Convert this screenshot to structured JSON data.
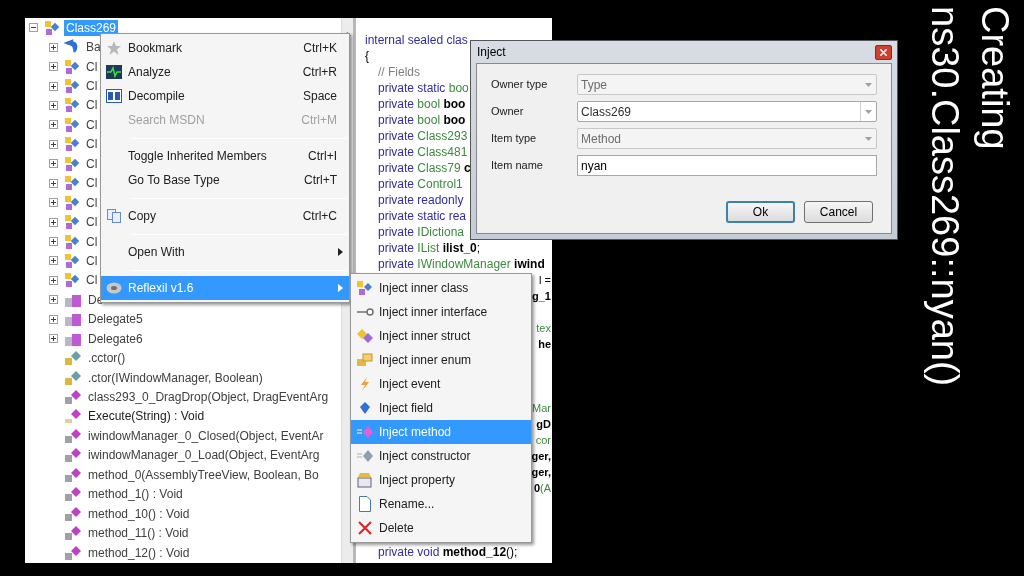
{
  "tree": {
    "items": [
      {
        "label": "Class269",
        "kind": "class",
        "selected": true,
        "expanded": true,
        "children": [
          {
            "label": "Ba",
            "kind": "base",
            "selected": false,
            "expanded": false
          },
          {
            "label": "Cl",
            "kind": "class",
            "selected": false,
            "expanded": false
          },
          {
            "label": "Cl",
            "kind": "class",
            "selected": false,
            "expanded": false
          },
          {
            "label": "Cl",
            "kind": "class",
            "selected": false,
            "expanded": false
          },
          {
            "label": "Cl",
            "kind": "class",
            "selected": false,
            "expanded": false
          },
          {
            "label": "Cl",
            "kind": "class",
            "selected": false,
            "expanded": false
          },
          {
            "label": "Cl",
            "kind": "class",
            "selected": false,
            "expanded": false
          },
          {
            "label": "Cl",
            "kind": "class",
            "selected": false,
            "expanded": false
          },
          {
            "label": "Cl",
            "kind": "class",
            "selected": false,
            "expanded": false
          },
          {
            "label": "Cl",
            "kind": "class",
            "selected": false,
            "expanded": false
          },
          {
            "label": "Cl",
            "kind": "class",
            "selected": false,
            "expanded": false
          },
          {
            "label": "Cl",
            "kind": "class",
            "selected": false,
            "expanded": false
          },
          {
            "label": "Cl",
            "kind": "class",
            "selected": false,
            "expanded": false
          },
          {
            "label": "De",
            "kind": "delegate",
            "selected": false,
            "expanded": false
          },
          {
            "label": "Delegate5",
            "kind": "delegate",
            "selected": false,
            "expanded": false
          },
          {
            "label": "Delegate6",
            "kind": "delegate",
            "selected": false,
            "expanded": false
          },
          {
            "label": ".cctor()",
            "kind": "ctor",
            "selected": false
          },
          {
            "label": ".ctor(IWindowManager, Boolean)",
            "kind": "ctor",
            "selected": false
          },
          {
            "label": "class293_0_DragDrop(Object, DragEventArg",
            "kind": "method",
            "selected": false
          },
          {
            "label": "Execute(String) : Void",
            "kind": "public_method",
            "selected": false
          },
          {
            "label": "iwindowManager_0_Closed(Object, EventAr",
            "kind": "method",
            "selected": false
          },
          {
            "label": "iwindowManager_0_Load(Object, EventArg",
            "kind": "method",
            "selected": false
          },
          {
            "label": "method_0(AssemblyTreeView, Boolean, Bo",
            "kind": "method",
            "selected": false
          },
          {
            "label": "method_1() : Void",
            "kind": "method",
            "selected": false
          },
          {
            "label": "method_10() : Void",
            "kind": "method",
            "selected": false
          },
          {
            "label": "method_11() : Void",
            "kind": "method",
            "selected": false
          },
          {
            "label": "method_12() : Void",
            "kind": "method",
            "selected": false
          }
        ]
      }
    ]
  },
  "code": {
    "lines": [
      {
        "kind": "top",
        "segments": [
          {
            "text": "internal sealed clas",
            "kind": "keyword"
          }
        ]
      },
      {
        "kind": "top",
        "segments": [
          {
            "text": "{",
            "kind": "plain"
          }
        ]
      },
      {
        "kind": "code",
        "segments": [
          {
            "text": "// Fields",
            "kind": "comment"
          }
        ]
      },
      {
        "kind": "code",
        "segments": [
          {
            "text": "private static ",
            "kind": "keyword"
          },
          {
            "text": "boo",
            "kind": "type"
          }
        ]
      },
      {
        "kind": "code",
        "segments": [
          {
            "text": "private ",
            "kind": "keyword"
          },
          {
            "text": "bool ",
            "kind": "type"
          },
          {
            "text": "boo",
            "kind": "ident"
          }
        ]
      },
      {
        "kind": "code",
        "segments": [
          {
            "text": "private ",
            "kind": "keyword"
          },
          {
            "text": "bool ",
            "kind": "type"
          },
          {
            "text": "boo",
            "kind": "ident"
          }
        ]
      },
      {
        "kind": "code",
        "segments": [
          {
            "text": "private ",
            "kind": "keyword"
          },
          {
            "text": "Class293",
            "kind": "type"
          }
        ]
      },
      {
        "kind": "code",
        "segments": [
          {
            "text": "private ",
            "kind": "keyword"
          },
          {
            "text": "Class481",
            "kind": "type"
          }
        ]
      },
      {
        "kind": "code",
        "segments": [
          {
            "text": "private ",
            "kind": "keyword"
          },
          {
            "text": "Class79 ",
            "kind": "type"
          },
          {
            "text": "c",
            "kind": "ident"
          }
        ]
      },
      {
        "kind": "code",
        "segments": [
          {
            "text": "private ",
            "kind": "keyword"
          },
          {
            "text": "Control1",
            "kind": "type"
          }
        ]
      },
      {
        "kind": "code",
        "segments": [
          {
            "text": "private readonly",
            "kind": "keyword"
          }
        ]
      },
      {
        "kind": "code",
        "segments": [
          {
            "text": "private static rea",
            "kind": "keyword"
          }
        ]
      },
      {
        "kind": "code",
        "segments": [
          {
            "text": "private ",
            "kind": "keyword"
          },
          {
            "text": "IDictiona",
            "kind": "type"
          }
        ]
      },
      {
        "kind": "code",
        "segments": [
          {
            "text": "private ",
            "kind": "keyword"
          },
          {
            "text": "IList ",
            "kind": "type"
          },
          {
            "text": "ilist_0",
            "kind": "ident"
          },
          {
            "text": ";",
            "kind": "plain"
          }
        ]
      },
      {
        "kind": "code",
        "segments": [
          {
            "text": "private ",
            "kind": "keyword"
          },
          {
            "text": "IWindowManager ",
            "kind": "type"
          },
          {
            "text": "iwind",
            "kind": "ident"
          }
        ]
      },
      {
        "kind": "fragment",
        "segments": [
          {
            "text": "l =",
            "kind": "plain"
          }
        ]
      },
      {
        "kind": "fragment",
        "segments": [
          {
            "text": "g_1",
            "kind": "ident"
          }
        ]
      },
      {
        "kind": "blank"
      },
      {
        "kind": "fragment",
        "segments": [
          {
            "text": "tex",
            "kind": "type"
          }
        ]
      },
      {
        "kind": "fragment",
        "segments": [
          {
            "text": "he",
            "kind": "ident"
          }
        ]
      },
      {
        "kind": "blank"
      },
      {
        "kind": "blank"
      },
      {
        "kind": "blank"
      },
      {
        "kind": "fragment",
        "segments": [
          {
            "text": "Mar",
            "kind": "type"
          }
        ]
      },
      {
        "kind": "fragment",
        "segments": [
          {
            "text": "gD",
            "kind": "ident"
          }
        ]
      },
      {
        "kind": "fragment",
        "segments": [
          {
            "text": "cor",
            "kind": "type"
          }
        ]
      },
      {
        "kind": "fragment",
        "segments": [
          {
            "text": "ger,",
            "kind": "ident"
          }
        ]
      },
      {
        "kind": "fragment",
        "segments": [
          {
            "text": "ger,",
            "kind": "ident"
          }
        ]
      },
      {
        "kind": "fragment",
        "segments": [
          {
            "text": "0",
            "kind": "ident"
          },
          {
            "text": "(A",
            "kind": "type"
          }
        ]
      },
      {
        "kind": "blank"
      },
      {
        "kind": "blank"
      },
      {
        "kind": "blank"
      },
      {
        "kind": "code",
        "segments": [
          {
            "text": "private void ",
            "kind": "keyword"
          },
          {
            "text": "method_12",
            "kind": "ident"
          },
          {
            "text": "();",
            "kind": "plain"
          }
        ]
      }
    ]
  },
  "context_menu": {
    "items": [
      {
        "kind": "item",
        "label": "Bookmark",
        "shortcut": "Ctrl+K",
        "disabled": false,
        "selected": false,
        "submenu": false
      },
      {
        "kind": "item",
        "label": "Analyze",
        "shortcut": "Ctrl+R",
        "disabled": false,
        "selected": false,
        "submenu": false
      },
      {
        "kind": "item",
        "label": "Decompile",
        "shortcut": "Space",
        "disabled": false,
        "selected": false,
        "submenu": false
      },
      {
        "kind": "item",
        "label": "Search MSDN",
        "shortcut": "Ctrl+M",
        "disabled": true,
        "selected": false,
        "submenu": false
      },
      {
        "kind": "separator"
      },
      {
        "kind": "item",
        "label": "Toggle Inherited Members",
        "shortcut": "Ctrl+I",
        "disabled": false,
        "selected": false,
        "submenu": false
      },
      {
        "kind": "item",
        "label": "Go To Base Type",
        "shortcut": "Ctrl+T",
        "disabled": false,
        "selected": false,
        "submenu": false
      },
      {
        "kind": "separator"
      },
      {
        "kind": "item",
        "label": "Copy",
        "shortcut": "Ctrl+C",
        "disabled": false,
        "selected": false,
        "submenu": false
      },
      {
        "kind": "separator"
      },
      {
        "kind": "item",
        "label": "Open With",
        "disabled": false,
        "selected": false,
        "submenu": true
      },
      {
        "kind": "separator"
      },
      {
        "kind": "item",
        "label": "Reflexil v1.6",
        "disabled": false,
        "selected": true,
        "submenu": true
      }
    ]
  },
  "submenu": {
    "items": [
      {
        "label": "Inject inner class",
        "selected": false
      },
      {
        "label": "Inject inner interface",
        "selected": false
      },
      {
        "label": "Inject inner struct",
        "selected": false
      },
      {
        "label": "Inject inner enum",
        "selected": false
      },
      {
        "label": "Inject event",
        "selected": false
      },
      {
        "label": "Inject field",
        "selected": false
      },
      {
        "label": "Inject method",
        "selected": true
      },
      {
        "label": "Inject constructor",
        "selected": false
      },
      {
        "label": "Inject property",
        "selected": false
      },
      {
        "label": "Rename...",
        "selected": false
      },
      {
        "label": "Delete",
        "selected": false
      }
    ]
  },
  "dialog": {
    "title": "Inject",
    "fields": [
      {
        "label": "Owner type",
        "kind": "combo",
        "value": "Type",
        "disabled": true
      },
      {
        "label": "Owner",
        "kind": "combo",
        "value": "Class269",
        "disabled": false
      },
      {
        "label": "Item type",
        "kind": "combo",
        "value": "Method",
        "disabled": true
      },
      {
        "label": "Item name",
        "kind": "text",
        "value": "nyan"
      }
    ],
    "buttons": [
      {
        "label": "Ok",
        "default": true
      },
      {
        "label": "Cancel",
        "default": false
      }
    ]
  },
  "caption": {
    "lines": [
      "Creating",
      "ns30.Class269::nyan()"
    ]
  }
}
